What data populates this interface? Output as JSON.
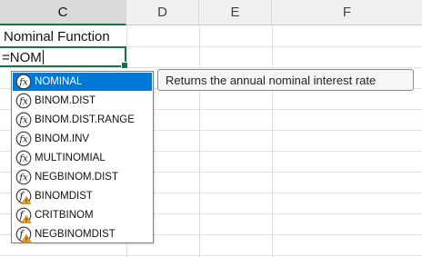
{
  "columns": [
    {
      "label": "C",
      "selected": true
    },
    {
      "label": "D",
      "selected": false
    },
    {
      "label": "E",
      "selected": false
    },
    {
      "label": "F",
      "selected": false
    }
  ],
  "cells": {
    "title_cell": "Nominal Function",
    "edit_cell_value": "=NOM"
  },
  "autocomplete": {
    "items": [
      {
        "label": "NOMINAL",
        "icon": "function-icon",
        "selected": true
      },
      {
        "label": "BINOM.DIST",
        "icon": "function-icon",
        "selected": false
      },
      {
        "label": "BINOM.DIST.RANGE",
        "icon": "function-icon",
        "selected": false
      },
      {
        "label": "BINOM.INV",
        "icon": "function-icon",
        "selected": false
      },
      {
        "label": "MULTINOMIAL",
        "icon": "function-icon",
        "selected": false
      },
      {
        "label": "NEGBINOM.DIST",
        "icon": "function-icon",
        "selected": false
      },
      {
        "label": "BINOMDIST",
        "icon": "compatibility-function-icon",
        "selected": false
      },
      {
        "label": "CRITBINOM",
        "icon": "compatibility-function-icon",
        "selected": false
      },
      {
        "label": "NEGBINOMDIST",
        "icon": "compatibility-function-icon",
        "selected": false
      }
    ]
  },
  "tooltip": {
    "text": "Returns the annual nominal interest rate"
  },
  "colors": {
    "selection_green": "#1e7145",
    "highlight_blue": "#0078d7",
    "warning_orange": "#e8a317"
  }
}
